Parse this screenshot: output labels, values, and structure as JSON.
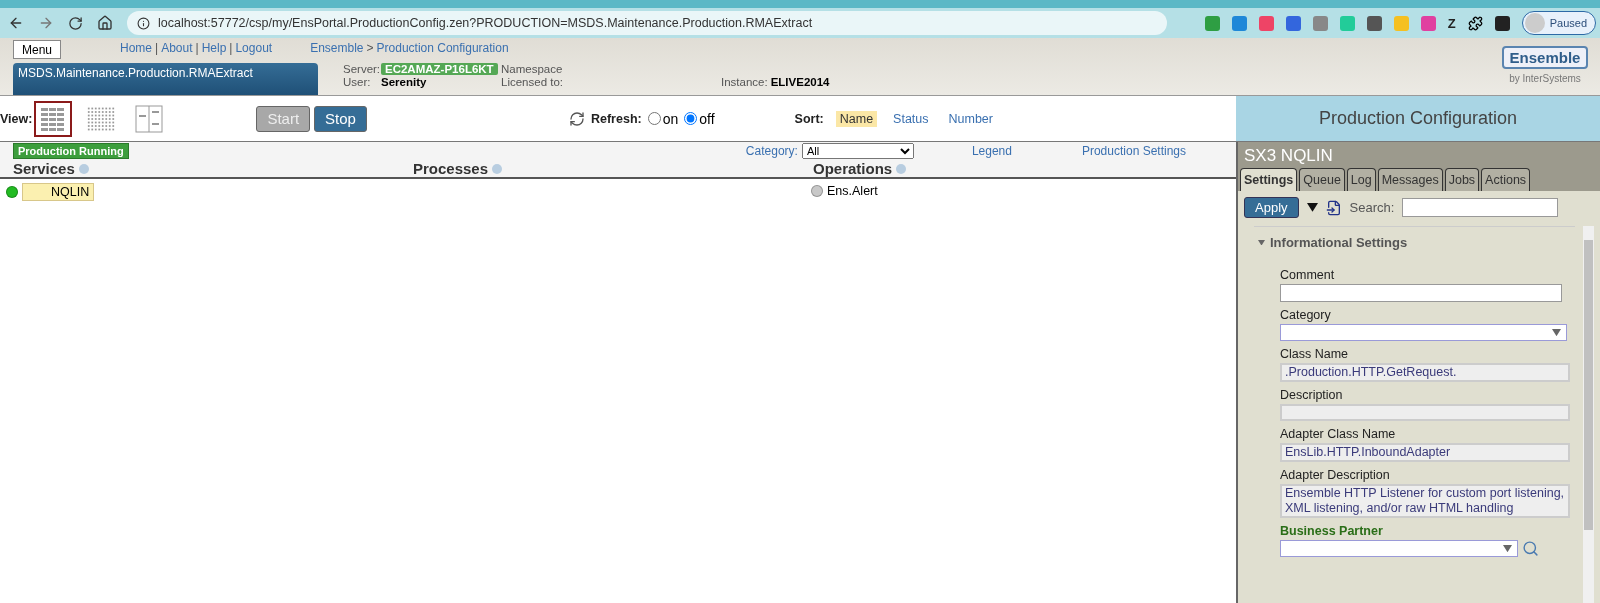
{
  "browser": {
    "url": "localhost:57772/csp/my/EnsPortal.ProductionConfig.zen?PRODUCTION=MSDS.Maintenance.Production.RMAExtract",
    "extension_letter": "Z",
    "profile": "Paused"
  },
  "header": {
    "menu": "Menu",
    "links": [
      "Home",
      "About",
      "Help",
      "Logout"
    ],
    "link_separator": "|",
    "breadcrumb": [
      "Ensemble",
      "Production Configuration"
    ],
    "breadcrumb_separator": ">",
    "production": "MSDS.Maintenance.Production.RMAExtract",
    "server_label": "Server:",
    "server": "EC2AMAZ-P16L6KT",
    "user_label": "User:",
    "user": "Serenity",
    "namespace_label": "Namespace",
    "licensed_label": "Licensed to:",
    "instance_label": "Instance:",
    "instance": "ELIVE2014",
    "logo": "Ensemble",
    "logo_sub": "by InterSystems"
  },
  "toolbar": {
    "view_label": "View:",
    "views": [
      {
        "kind": "columns",
        "selected": true
      },
      {
        "kind": "grid",
        "selected": false
      },
      {
        "kind": "split",
        "selected": false
      }
    ],
    "buttons": [
      {
        "label": "Start",
        "disabled": true
      },
      {
        "label": "Stop",
        "disabled": false
      }
    ],
    "refresh_label": "Refresh:",
    "refresh": [
      {
        "label": "on",
        "selected": false
      },
      {
        "label": "off",
        "selected": true
      }
    ],
    "sort_label": "Sort:",
    "sort": [
      {
        "label": "Name",
        "selected": true
      },
      {
        "label": "Status",
        "selected": false
      },
      {
        "label": "Number",
        "selected": false
      }
    ],
    "page_title": "Production Configuration"
  },
  "diagram": {
    "status": "Production Running",
    "category_label": "Category:",
    "category": "All",
    "links": [
      "Legend",
      "Production Settings"
    ],
    "columns": [
      {
        "title": "Services",
        "items": [
          {
            "name": "NQLIN",
            "color": "#22bb22",
            "selected": true
          }
        ]
      },
      {
        "title": "Processes"
      },
      {
        "title": "Operations",
        "items": [
          {
            "name": "Ens.Alert",
            "color": "#c8c8c8",
            "selected": false
          }
        ]
      }
    ]
  },
  "details": {
    "title": "SX3 NQLIN",
    "tabs": [
      {
        "label": "Settings",
        "selected": true
      },
      {
        "label": "Queue",
        "selected": false
      },
      {
        "label": "Log",
        "selected": false
      },
      {
        "label": "Messages",
        "selected": false
      },
      {
        "label": "Jobs",
        "selected": false
      },
      {
        "label": "Actions",
        "selected": false
      }
    ],
    "apply": "Apply",
    "search_label": "Search:",
    "section": "Informational Settings",
    "expanded": true,
    "fields": [
      {
        "label": "Comment",
        "kind": "text"
      },
      {
        "label": "Category",
        "kind": "select"
      },
      {
        "label": "Class Name",
        "kind": "readonly",
        "value": ".Production.HTTP.GetRequest."
      },
      {
        "label": "Description",
        "kind": "readonly"
      },
      {
        "label": "Adapter Class Name",
        "kind": "readonly",
        "value": "EnsLib.HTTP.InboundAdapter"
      },
      {
        "label": "Adapter Description",
        "kind": "readonly",
        "value": "Ensemble HTTP Listener for custom port listening, XML listening, and/or raw HTML handling"
      },
      {
        "label": "Business Partner",
        "kind": "partner"
      }
    ]
  }
}
